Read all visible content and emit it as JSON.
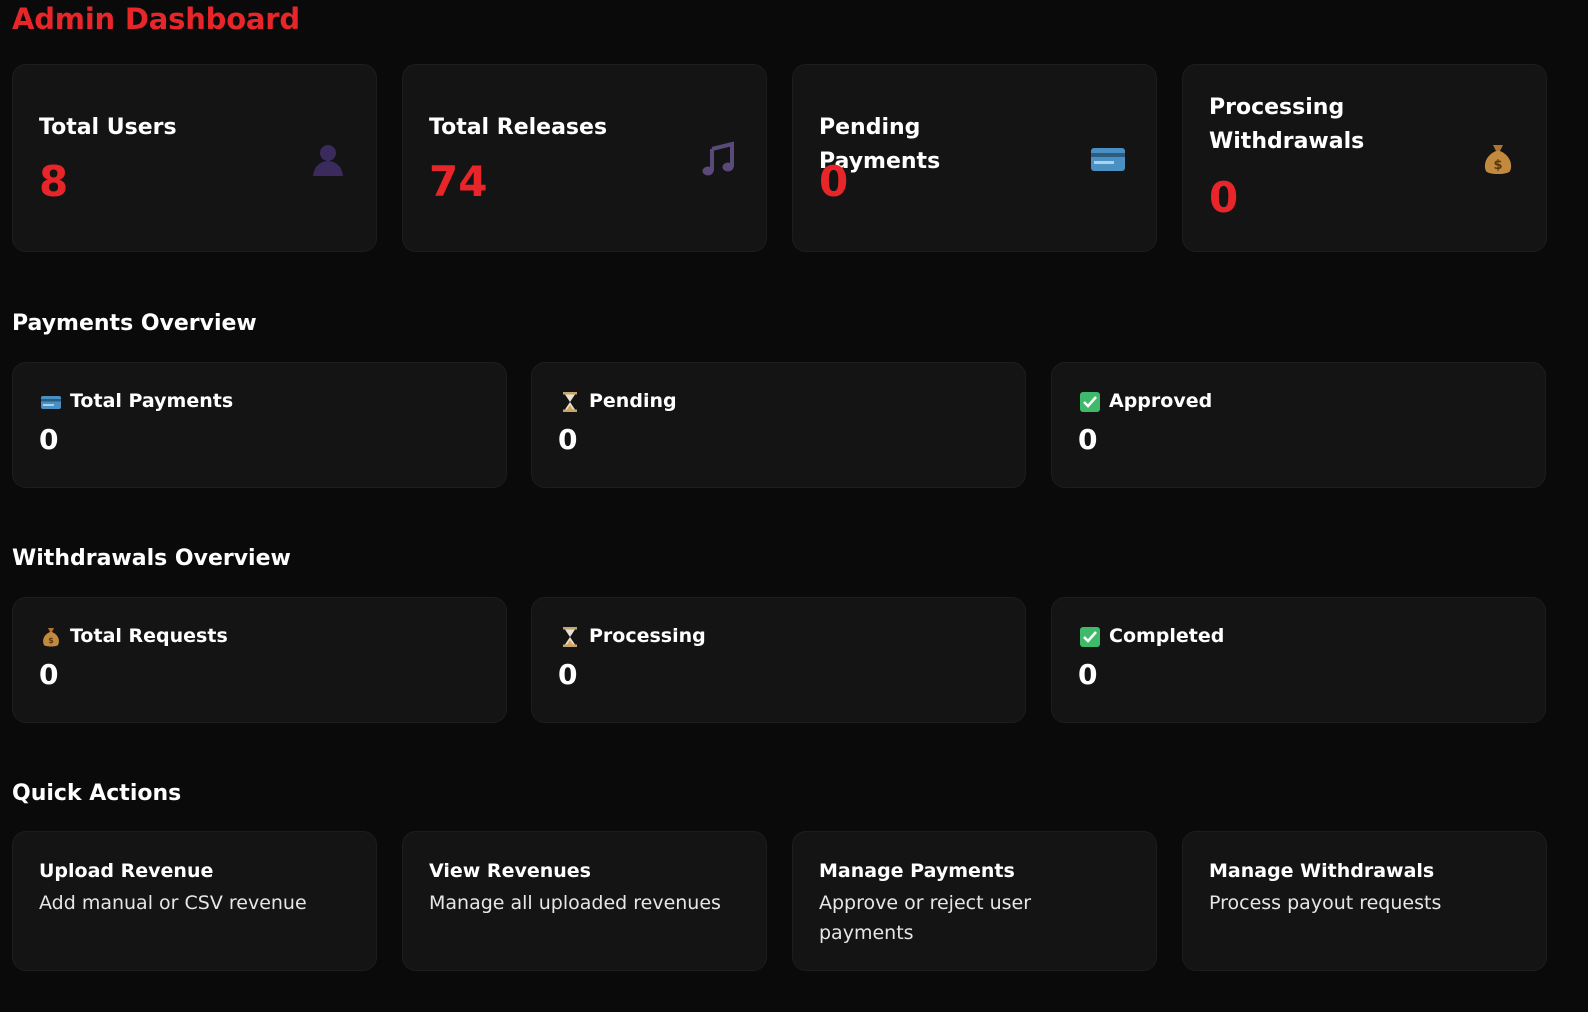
{
  "page": {
    "title": "Admin Dashboard",
    "accent_color": "#e8262a"
  },
  "stats": [
    {
      "label": "Total Users",
      "value": "8",
      "icon": "user-icon"
    },
    {
      "label": "Total Releases",
      "value": "74",
      "icon": "music-note-icon"
    },
    {
      "label": "Pending Payments",
      "value": "0",
      "icon": "credit-card-icon"
    },
    {
      "label": "Processing Withdrawals",
      "value": "0",
      "icon": "money-bag-icon"
    }
  ],
  "payments_overview": {
    "title": "Payments Overview",
    "items": [
      {
        "label": "Total Payments",
        "value": "0",
        "icon": "credit-card-icon"
      },
      {
        "label": "Pending",
        "value": "0",
        "icon": "hourglass-icon"
      },
      {
        "label": "Approved",
        "value": "0",
        "icon": "check-box-icon"
      }
    ]
  },
  "withdrawals_overview": {
    "title": "Withdrawals Overview",
    "items": [
      {
        "label": "Total Requests",
        "value": "0",
        "icon": "money-bag-icon"
      },
      {
        "label": "Processing",
        "value": "0",
        "icon": "hourglass-icon"
      },
      {
        "label": "Completed",
        "value": "0",
        "icon": "check-box-icon"
      }
    ]
  },
  "quick_actions": {
    "title": "Quick Actions",
    "items": [
      {
        "title": "Upload Revenue",
        "description": "Add manual or CSV revenue"
      },
      {
        "title": "View Revenues",
        "description": "Manage all uploaded revenues"
      },
      {
        "title": "Manage Payments",
        "description": "Approve or reject user payments"
      },
      {
        "title": "Manage Withdrawals",
        "description": "Process payout requests"
      }
    ]
  }
}
